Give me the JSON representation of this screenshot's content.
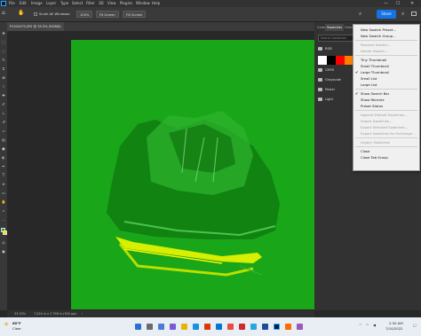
{
  "menubar": {
    "items": [
      "File",
      "Edit",
      "Image",
      "Layer",
      "Type",
      "Select",
      "Filter",
      "3D",
      "View",
      "Plugins",
      "Window",
      "Help"
    ]
  },
  "options": {
    "scroll_all_windows": "Scroll All Windows",
    "zoom": "100%",
    "fit_screen": "Fit Screen",
    "fill_screen": "Fill Screen",
    "share": "Share"
  },
  "document": {
    "tab_title": "P1010572.JPG @ 33.3% (RGB/8)",
    "zoom_status": "33.33%",
    "dimensions": "7,024 in x 7,798 in (300 ppi)"
  },
  "panel": {
    "tabs": [
      "Color",
      "Swatches",
      "Gradi"
    ],
    "search_placeholder": "Search Swatches",
    "groups": [
      "RGB",
      "CMYK",
      "Grayscale",
      "Pastel",
      "Light"
    ],
    "swatch_colors": [
      "#ffffff",
      "#000000",
      "#ff0000",
      "#ff7f00",
      "#ffff00"
    ]
  },
  "context_menu": {
    "items": [
      {
        "label": "New Swatch Preset...",
        "disabled": false,
        "checked": false
      },
      {
        "label": "New Swatch Group...",
        "disabled": false,
        "checked": false
      },
      {
        "sep": true
      },
      {
        "label": "Rename Swatch...",
        "disabled": true,
        "checked": false
      },
      {
        "label": "Delete Swatch...",
        "disabled": true,
        "checked": false
      },
      {
        "sep": true
      },
      {
        "label": "Tiny Thumbnail",
        "disabled": false,
        "checked": false
      },
      {
        "label": "Small Thumbnail",
        "disabled": false,
        "checked": false
      },
      {
        "label": "Large Thumbnail",
        "disabled": false,
        "checked": true
      },
      {
        "label": "Small List",
        "disabled": false,
        "checked": false
      },
      {
        "label": "Large List",
        "disabled": false,
        "checked": false
      },
      {
        "sep": true
      },
      {
        "label": "Show Search Bar",
        "disabled": false,
        "checked": true
      },
      {
        "label": "Show Recents",
        "disabled": false,
        "checked": false
      },
      {
        "label": "Preset Status",
        "disabled": false,
        "checked": false
      },
      {
        "sep": true
      },
      {
        "label": "Append Default Swatches...",
        "disabled": true,
        "checked": false
      },
      {
        "label": "Import Swatches...",
        "disabled": true,
        "checked": false
      },
      {
        "label": "Export Selected Swatches...",
        "disabled": true,
        "checked": false
      },
      {
        "label": "Export Swatches for Exchange...",
        "disabled": true,
        "checked": false
      },
      {
        "sep": true
      },
      {
        "label": "Legacy Swatches",
        "disabled": true,
        "checked": false
      },
      {
        "sep": true
      },
      {
        "label": "Close",
        "disabled": false,
        "checked": false
      },
      {
        "label": "Close Tab Group",
        "disabled": false,
        "checked": false
      }
    ]
  },
  "taskbar": {
    "weather_temp": "60°F",
    "weather_desc": "Clear",
    "time": "2:30 AM",
    "date": "7/10/2022"
  },
  "colors": {
    "canvas_green": "#18a418",
    "accent": "#1473e6"
  }
}
